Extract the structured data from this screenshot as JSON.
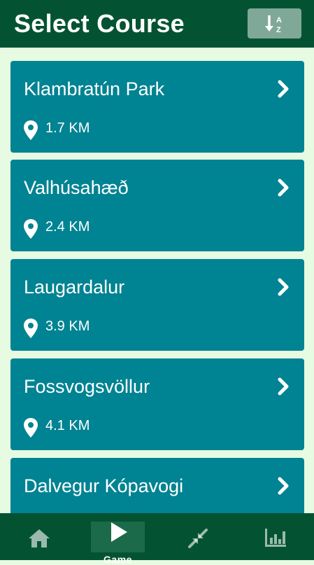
{
  "header": {
    "title": "Select Course",
    "sort_icon": "sort-alpha-down-icon"
  },
  "courses": [
    {
      "name": "Klambratún Park",
      "distance": "1.7 KM"
    },
    {
      "name": "Valhúsahæð",
      "distance": "2.4 KM"
    },
    {
      "name": "Laugardalur",
      "distance": "3.9 KM"
    },
    {
      "name": "Fossvogsvöllur",
      "distance": "4.1 KM"
    },
    {
      "name": "Dalvegur Kópavogi",
      "distance": ""
    }
  ],
  "bottom_nav": {
    "items": [
      {
        "icon": "home-icon",
        "label": ""
      },
      {
        "icon": "play-icon",
        "label": "Game",
        "active": true
      },
      {
        "icon": "compress-arrows-icon",
        "label": ""
      },
      {
        "icon": "bar-chart-icon",
        "label": ""
      }
    ]
  },
  "colors": {
    "header_bg": "#035332",
    "page_bg": "#e6fbe2",
    "card_bg": "#008392",
    "sort_button_bg": "#7fa898",
    "nav_active_bg": "#1b6a4a"
  }
}
